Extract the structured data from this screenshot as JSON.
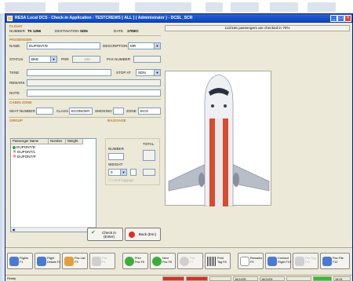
{
  "window": {
    "title": "RESA Local DCS - Check-in Application - TESTCREWS [ ALL ] ( Administrator ) - DCSL_SCR"
  },
  "form": {
    "flight_section": "FLIGHT",
    "number_label": "NUMBER",
    "number_value": "TA 1256",
    "destination_label": "DESTINATION",
    "destination_value": "SDN",
    "date_label": "DATE",
    "date_value": "17DEC",
    "passenger_section": "PASSENGER",
    "name_label": "NAME",
    "name_value": "DUPONT/D",
    "description_label": "DESCRIPTION",
    "description_value": "MR",
    "status_label": "STATUS",
    "status_value": "BKE",
    "pnr_label": "PNR",
    "pnr_value": "100",
    "pax_number_label": "PAX NUMBER",
    "tkne_label": "TKNE",
    "stop_at_label": "STOP AT",
    "stop_at_value": "SDN",
    "remark_label": "REMARK",
    "note_label": "NOTE",
    "cabin_section": "CABIN ZONE",
    "seat_number_label": "SEAT NUMBER",
    "class_label": "CLASS",
    "class_value": "ECONOMY",
    "smoking_label": "SMOKING",
    "zone_label": "ZONE",
    "zone_value": "ECO",
    "group_section": "GROUP",
    "baggage_section": "BAGGAGE",
    "bag_number_label": "NUMBER",
    "bag_weight_label": "WEIGHT",
    "bag_weight_value": "0",
    "bag_total_label": "TOTAL",
    "limit_luggage_label": "Limit luggage"
  },
  "group_grid": {
    "headers": [
      "Passenger Name",
      "Number",
      "Weight"
    ],
    "rows": [
      {
        "name": "DUPONT/D",
        "status": "ok"
      },
      {
        "name": "DUPONT/L",
        "status": "x"
      },
      {
        "name": "DUPONT/P",
        "status": "x"
      }
    ]
  },
  "actions": {
    "checkin_label": "Check in",
    "checkin_key": "(Enter)",
    "back_label": "Back (Esc)"
  },
  "right": {
    "info": "113/166 passengers are checked in 70%"
  },
  "toolbar": {
    "buttons": [
      {
        "l1": "Flights",
        "l2": "F1",
        "dim": false,
        "color": "#4a7bd0"
      },
      {
        "l1": "Flight",
        "l2": "Details F2",
        "dim": false,
        "color": "#4a7bd0"
      },
      {
        "l1": "Pax List",
        "l2": "F3",
        "dim": false,
        "color": "#e0a040"
      },
      {
        "l1": "Pax",
        "l2": "F4",
        "dim": true,
        "color": "#cfcfcf"
      },
      {
        "l1": "Prev",
        "l2": "Pax F5",
        "dim": false,
        "color": "#3cae3c"
      },
      {
        "l1": "Next",
        "l2": "Pax F6",
        "dim": false,
        "color": "#3cae3c"
      },
      {
        "l1": "Pax",
        "l2": "F7",
        "dim": true,
        "color": "#cfcfcf"
      },
      {
        "l1": "Print",
        "l2": "Tag F8",
        "dim": false,
        "color": "#555555"
      },
      {
        "l1": "Remarks",
        "l2": "F9",
        "dim": false,
        "color": "#ffffff"
      },
      {
        "l1": "Connect",
        "l2": "Flight F10",
        "dim": false,
        "color": "#4a7bd0"
      },
      {
        "l1": "Pax Tag",
        "l2": "F11",
        "dim": true,
        "color": "#cfcfcf"
      },
      {
        "l1": "Pax File",
        "l2": "F12",
        "dim": false,
        "color": "#4a7bd0"
      }
    ]
  },
  "status_bar": {
    "ready": "Ready",
    "date1": "16/11/05",
    "date2": "16/11/05",
    "time": "16:04"
  },
  "colors": {
    "title_bar": "#0a3fb5",
    "section_label": "#c07a2a",
    "ok": "#2fa52f",
    "error": "#d02020",
    "status_red": "#d9302a",
    "status_green": "#2fc02f"
  }
}
